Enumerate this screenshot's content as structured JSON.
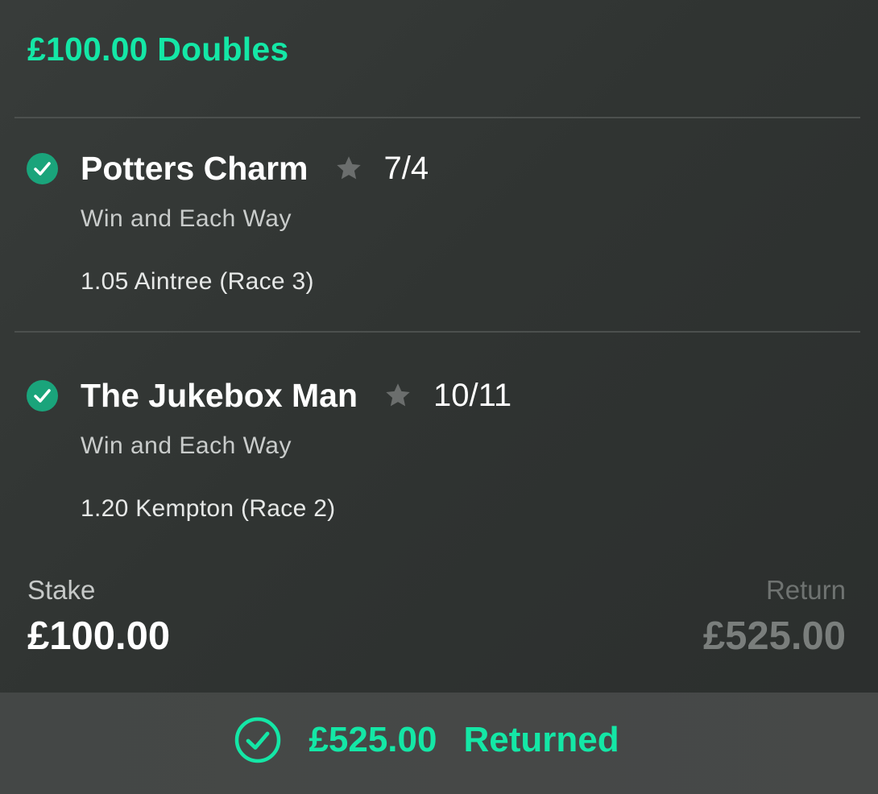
{
  "bet": {
    "title": "£100.00 Doubles",
    "accent_color": "#14e7a6"
  },
  "selections": [
    {
      "status_icon": "check-circle-icon",
      "name": "Potters Charm",
      "favourite_icon": "star-icon",
      "odds": "7/4",
      "market": "Win and Each Way",
      "event": "1.05 Aintree (Race 3)"
    },
    {
      "status_icon": "check-circle-icon",
      "name": "The Jukebox Man",
      "favourite_icon": "star-icon",
      "odds": "10/11",
      "market": "Win and Each Way",
      "event": "1.20 Kempton (Race 2)"
    }
  ],
  "summary": {
    "stake_label": "Stake",
    "stake_value": "£100.00",
    "return_label": "Return",
    "return_value": "£525.00"
  },
  "footer": {
    "icon": "check-circle-outline-icon",
    "amount": "£525.00",
    "status": "Returned"
  }
}
